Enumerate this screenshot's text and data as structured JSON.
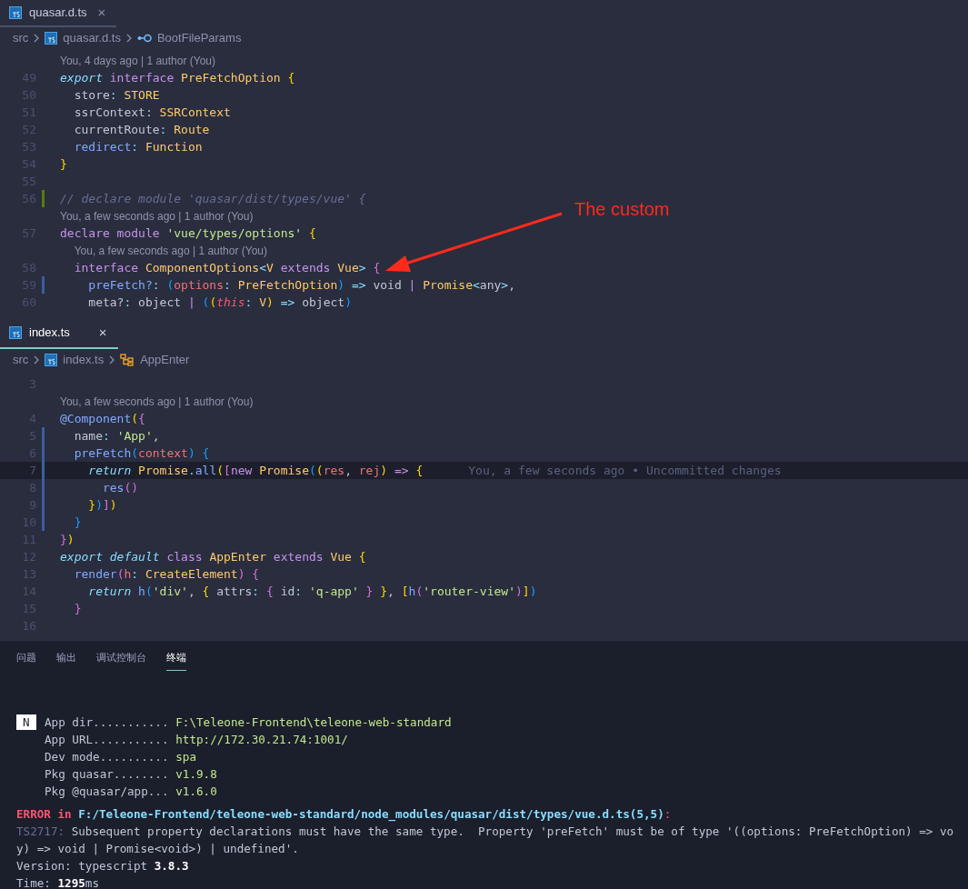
{
  "editors": [
    {
      "focused": false,
      "tab": {
        "label": "quasar.d.ts",
        "selected": true,
        "close": "×"
      },
      "breadcrumb": {
        "folder": "src",
        "file": "quasar.d.ts",
        "symbol": {
          "label": "BootFileParams",
          "kind": "interface"
        }
      },
      "lines": [
        {
          "n": "49",
          "lens": "You, 4 days ago | 1 author (You)",
          "tokens": [
            {
              "text": "export ",
              "kind": "i"
            },
            {
              "text": "interface",
              "kind": "k"
            },
            {
              "text": " PreFetchOption ",
              "kind": "t"
            },
            {
              "text": "{",
              "kind": "y"
            }
          ]
        },
        {
          "n": "50",
          "tokens": [
            {
              "text": "  store",
              "kind": "x"
            },
            {
              "text": ": ",
              "kind": "o"
            },
            {
              "text": "STORE",
              "kind": "t"
            }
          ]
        },
        {
          "n": "51",
          "tokens": [
            {
              "text": "  ssrContext",
              "kind": "x"
            },
            {
              "text": ": ",
              "kind": "o"
            },
            {
              "text": "SSRContext",
              "kind": "t"
            }
          ]
        },
        {
          "n": "52",
          "tokens": [
            {
              "text": "  currentRoute",
              "kind": "x"
            },
            {
              "text": ": ",
              "kind": "o"
            },
            {
              "text": "Route",
              "kind": "t"
            }
          ]
        },
        {
          "n": "53",
          "tokens": [
            {
              "text": "  redirect",
              "kind": "p"
            },
            {
              "text": ": ",
              "kind": "o"
            },
            {
              "text": "Function",
              "kind": "t"
            }
          ]
        },
        {
          "n": "54",
          "tokens": [
            {
              "text": "}",
              "kind": "y"
            }
          ]
        },
        {
          "n": "55"
        },
        {
          "n": "56",
          "added": true,
          "tokens": [
            {
              "text": "// declare module 'quasar/dist/types/vue' {",
              "kind": "c"
            }
          ]
        },
        {
          "n": "57",
          "lens": "You, a few seconds ago | 1 author (You)",
          "tokens": [
            {
              "text": "declare module ",
              "kind": "k"
            },
            {
              "text": "'vue/types/options' ",
              "kind": "s"
            },
            {
              "text": "{",
              "kind": "y"
            }
          ]
        },
        {
          "n": "58",
          "lens": "You, a few seconds ago | 1 author (You)",
          "tokens": [
            {
              "text": "  interface ",
              "kind": "k"
            },
            {
              "text": "ComponentOptions",
              "kind": "t"
            },
            {
              "text": "<",
              "kind": "o"
            },
            {
              "text": "V",
              "kind": "t"
            },
            {
              "text": " extends ",
              "kind": "k"
            },
            {
              "text": "Vue",
              "kind": "t"
            },
            {
              "text": "> ",
              "kind": "o"
            },
            {
              "text": "{",
              "kind": "m"
            }
          ]
        },
        {
          "n": "59",
          "modified": true,
          "tokens": [
            {
              "text": "    preFetch?",
              "kind": "p"
            },
            {
              "text": ": ",
              "kind": "o"
            },
            {
              "text": "(",
              "kind": "b"
            },
            {
              "text": "options",
              "kind": "v"
            },
            {
              "text": ": ",
              "kind": "o"
            },
            {
              "text": "PreFetchOption",
              "kind": "t"
            },
            {
              "text": ")",
              "kind": "b"
            },
            {
              "text": " => ",
              "kind": "o"
            },
            {
              "text": "void",
              "kind": "x"
            },
            {
              "text": " | ",
              "kind": "k"
            },
            {
              "text": "Promise",
              "kind": "t"
            },
            {
              "text": "<",
              "kind": "o"
            },
            {
              "text": "any",
              "kind": "x"
            },
            {
              "text": ">",
              "kind": "o"
            },
            {
              "text": ",",
              "kind": "x"
            }
          ]
        },
        {
          "n": "60",
          "tokens": [
            {
              "text": "    meta?",
              "kind": "x"
            },
            {
              "text": ": ",
              "kind": "o"
            },
            {
              "text": "object",
              "kind": "x"
            },
            {
              "text": " | ",
              "kind": "k"
            },
            {
              "text": "(",
              "kind": "b"
            },
            {
              "text": "(",
              "kind": "y"
            },
            {
              "text": "this",
              "kind": "r"
            },
            {
              "text": ": ",
              "kind": "o"
            },
            {
              "text": "V",
              "kind": "t"
            },
            {
              "text": ")",
              "kind": "y"
            },
            {
              "text": " => ",
              "kind": "o"
            },
            {
              "text": "object",
              "kind": "x"
            },
            {
              "text": ")",
              "kind": "b"
            }
          ]
        }
      ]
    },
    {
      "focused": true,
      "tab": {
        "label": "index.ts",
        "selected": true,
        "close": "×"
      },
      "breadcrumb": {
        "folder": "src",
        "file": "index.ts",
        "symbol": {
          "label": "AppEnter",
          "kind": "class"
        }
      },
      "lines": [
        {
          "n": "3"
        },
        {
          "n": "4",
          "lens": "You, a few seconds ago | 1 author (You)",
          "tokens": [
            {
              "text": "@Component",
              "kind": "p"
            },
            {
              "text": "(",
              "kind": "y"
            },
            {
              "text": "{",
              "kind": "m"
            }
          ]
        },
        {
          "n": "5",
          "modified": true,
          "tokens": [
            {
              "text": "  name",
              "kind": "x"
            },
            {
              "text": ": ",
              "kind": "o"
            },
            {
              "text": "'App'",
              "kind": "s"
            },
            {
              "text": ",",
              "kind": "x"
            }
          ]
        },
        {
          "n": "6",
          "modified": true,
          "tokens": [
            {
              "text": "  preFetch",
              "kind": "p"
            },
            {
              "text": "(",
              "kind": "b"
            },
            {
              "text": "context",
              "kind": "v"
            },
            {
              "text": ") ",
              "kind": "b"
            },
            {
              "text": "{",
              "kind": "b"
            }
          ]
        },
        {
          "n": "7",
          "modified": true,
          "current": true,
          "blame": "You, a few seconds ago • Uncommitted changes",
          "tokens": [
            {
              "text": "    return",
              "kind": "i"
            },
            {
              "text": " Promise",
              "kind": "t"
            },
            {
              "text": ".",
              "kind": "o"
            },
            {
              "text": "all",
              "kind": "p"
            },
            {
              "text": "(",
              "kind": "y"
            },
            {
              "text": "[",
              "kind": "m"
            },
            {
              "text": "new",
              "kind": "k"
            },
            {
              "text": " Promise",
              "kind": "t"
            },
            {
              "text": "(",
              "kind": "b"
            },
            {
              "text": "(",
              "kind": "y"
            },
            {
              "text": "res",
              "kind": "v"
            },
            {
              "text": ", ",
              "kind": "x"
            },
            {
              "text": "rej",
              "kind": "v"
            },
            {
              "text": ")",
              "kind": "y"
            },
            {
              "text": " => ",
              "kind": "k"
            },
            {
              "text": "{",
              "kind": "y"
            }
          ]
        },
        {
          "n": "8",
          "modified": true,
          "tokens": [
            {
              "text": "      res",
              "kind": "p"
            },
            {
              "text": "()",
              "kind": "m"
            }
          ]
        },
        {
          "n": "9",
          "modified": true,
          "tokens": [
            {
              "text": "    }",
              "kind": "y"
            },
            {
              "text": ")",
              "kind": "b"
            },
            {
              "text": "]",
              "kind": "m"
            },
            {
              "text": ")",
              "kind": "y"
            }
          ]
        },
        {
          "n": "10",
          "modified": true,
          "tokens": [
            {
              "text": "  }",
              "kind": "b"
            }
          ]
        },
        {
          "n": "11",
          "tokens": [
            {
              "text": "}",
              "kind": "m"
            },
            {
              "text": ")",
              "kind": "y"
            }
          ]
        },
        {
          "n": "12",
          "tokens": [
            {
              "text": "export default",
              "kind": "i"
            },
            {
              "text": " class ",
              "kind": "k"
            },
            {
              "text": "AppEnter",
              "kind": "t"
            },
            {
              "text": " extends ",
              "kind": "k"
            },
            {
              "text": "Vue ",
              "kind": "t"
            },
            {
              "text": "{",
              "kind": "y"
            }
          ]
        },
        {
          "n": "13",
          "tokens": [
            {
              "text": "  render",
              "kind": "p"
            },
            {
              "text": "(",
              "kind": "m"
            },
            {
              "text": "h",
              "kind": "v"
            },
            {
              "text": ": ",
              "kind": "o"
            },
            {
              "text": "CreateElement",
              "kind": "t"
            },
            {
              "text": ") ",
              "kind": "m"
            },
            {
              "text": "{",
              "kind": "m"
            }
          ]
        },
        {
          "n": "14",
          "tokens": [
            {
              "text": "    return",
              "kind": "i"
            },
            {
              "text": " h",
              "kind": "p"
            },
            {
              "text": "(",
              "kind": "b"
            },
            {
              "text": "'div'",
              "kind": "s"
            },
            {
              "text": ", ",
              "kind": "x"
            },
            {
              "text": "{",
              "kind": "y"
            },
            {
              "text": " attrs",
              "kind": "x"
            },
            {
              "text": ": ",
              "kind": "o"
            },
            {
              "text": "{",
              "kind": "m"
            },
            {
              "text": " id",
              "kind": "x"
            },
            {
              "text": ": ",
              "kind": "o"
            },
            {
              "text": "'q-app'",
              "kind": "s"
            },
            {
              "text": " }",
              "kind": "m"
            },
            {
              "text": " }",
              "kind": "y"
            },
            {
              "text": ", ",
              "kind": "x"
            },
            {
              "text": "[",
              "kind": "y"
            },
            {
              "text": "h",
              "kind": "p"
            },
            {
              "text": "(",
              "kind": "m"
            },
            {
              "text": "'router-view'",
              "kind": "s"
            },
            {
              "text": ")",
              "kind": "m"
            },
            {
              "text": "]",
              "kind": "y"
            },
            {
              "text": ")",
              "kind": "b"
            }
          ]
        },
        {
          "n": "15",
          "tokens": [
            {
              "text": "  }",
              "kind": "m"
            }
          ]
        },
        {
          "n": "16"
        }
      ]
    }
  ],
  "annotation": {
    "text": "The custom"
  },
  "panel": {
    "tabs": [
      {
        "label": "问题",
        "selected": false
      },
      {
        "label": "输出",
        "selected": false
      },
      {
        "label": "调试控制台",
        "selected": false
      },
      {
        "label": "终端",
        "selected": true
      }
    ],
    "badge": "N",
    "info": [
      {
        "label": "App dir...........",
        "value": "F:\\Teleone-Frontend\\teleone-web-standard"
      },
      {
        "label": "App URL...........",
        "value": "http://172.30.21.74:1001/"
      },
      {
        "label": "Dev mode..........",
        "value": "spa"
      },
      {
        "label": "Pkg quasar........",
        "value": "v1.9.8"
      },
      {
        "label": "Pkg @quasar/app...",
        "value": "v1.6.0"
      }
    ],
    "error": {
      "level": "ERROR",
      "in": "in",
      "path": "F:/Teleone-Frontend/teleone-web-standard/node_modules/quasar/dist/types/vue.d.ts(5,5)",
      "colon": ":"
    },
    "code": "TS2717:",
    "message": "Subsequent property declarations must have the same type.  Property 'preFetch' must be of type '((options: PreFetchOption) => vo",
    "message_cont": "y) => void | Promise<void>) | undefined'.",
    "version": {
      "label": "Version: typescript",
      "value": "3.8.3"
    },
    "time": {
      "label": "Time:",
      "value": "1295",
      "unit": "ms"
    }
  }
}
